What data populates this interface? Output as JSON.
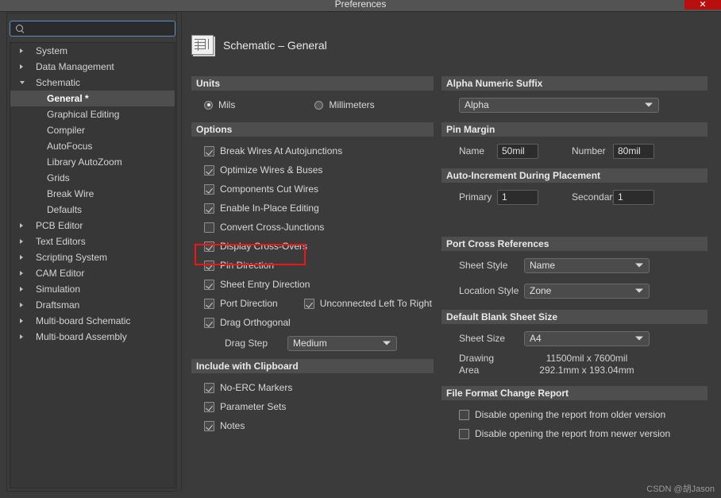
{
  "window": {
    "title": "Preferences",
    "close_label": "✕"
  },
  "sidebar": {
    "search": {
      "value": "",
      "placeholder": ""
    },
    "items": [
      {
        "label": "System",
        "level": 0,
        "state": "collapsed",
        "selected": false
      },
      {
        "label": "Data Management",
        "level": 0,
        "state": "collapsed",
        "selected": false
      },
      {
        "label": "Schematic",
        "level": 0,
        "state": "expanded",
        "selected": false
      },
      {
        "label": "General *",
        "level": 1,
        "state": "leaf",
        "selected": true
      },
      {
        "label": "Graphical Editing",
        "level": 1,
        "state": "leaf",
        "selected": false
      },
      {
        "label": "Compiler",
        "level": 1,
        "state": "leaf",
        "selected": false
      },
      {
        "label": "AutoFocus",
        "level": 1,
        "state": "leaf",
        "selected": false
      },
      {
        "label": "Library AutoZoom",
        "level": 1,
        "state": "leaf",
        "selected": false
      },
      {
        "label": "Grids",
        "level": 1,
        "state": "leaf",
        "selected": false
      },
      {
        "label": "Break Wire",
        "level": 1,
        "state": "leaf",
        "selected": false
      },
      {
        "label": "Defaults",
        "level": 1,
        "state": "leaf",
        "selected": false
      },
      {
        "label": "PCB Editor",
        "level": 0,
        "state": "collapsed",
        "selected": false
      },
      {
        "label": "Text Editors",
        "level": 0,
        "state": "collapsed",
        "selected": false
      },
      {
        "label": "Scripting System",
        "level": 0,
        "state": "collapsed",
        "selected": false
      },
      {
        "label": "CAM Editor",
        "level": 0,
        "state": "collapsed",
        "selected": false
      },
      {
        "label": "Simulation",
        "level": 0,
        "state": "collapsed",
        "selected": false
      },
      {
        "label": "Draftsman",
        "level": 0,
        "state": "collapsed",
        "selected": false
      },
      {
        "label": "Multi-board Schematic",
        "level": 0,
        "state": "collapsed",
        "selected": false
      },
      {
        "label": "Multi-board Assembly",
        "level": 0,
        "state": "collapsed",
        "selected": false
      }
    ]
  },
  "page": {
    "title": "Schematic – General",
    "icon": "schematic-icon"
  },
  "units": {
    "header": "Units",
    "options": [
      {
        "label": "Mils",
        "checked": true
      },
      {
        "label": "Millimeters",
        "checked": false
      }
    ]
  },
  "options": {
    "header": "Options",
    "items": [
      {
        "label": "Break Wires At Autojunctions",
        "checked": true
      },
      {
        "label": "Optimize Wires & Buses",
        "checked": true
      },
      {
        "label": "Components Cut Wires",
        "checked": true
      },
      {
        "label": "Enable In-Place Editing",
        "checked": true
      },
      {
        "label": "Convert Cross-Junctions",
        "checked": false
      },
      {
        "label": "Display Cross-Overs",
        "checked": true,
        "highlighted": true
      },
      {
        "label": "Pin Direction",
        "checked": true
      },
      {
        "label": "Sheet Entry Direction",
        "checked": true
      },
      {
        "label": "Port Direction",
        "checked": true
      },
      {
        "label": "Drag Orthogonal",
        "checked": true
      }
    ],
    "unconnected_left_to_right": {
      "label": "Unconnected Left To Right",
      "checked": true
    },
    "drag_step": {
      "label": "Drag Step",
      "value": "Medium"
    }
  },
  "clipboard": {
    "header": "Include with Clipboard",
    "items": [
      {
        "label": "No-ERC Markers",
        "checked": true
      },
      {
        "label": "Parameter Sets",
        "checked": true
      },
      {
        "label": "Notes",
        "checked": true
      }
    ]
  },
  "alpha_numeric_suffix": {
    "header": "Alpha Numeric Suffix",
    "value": "Alpha"
  },
  "pin_margin": {
    "header": "Pin Margin",
    "name_label": "Name",
    "name_value": "50mil",
    "number_label": "Number",
    "number_value": "80mil"
  },
  "auto_increment": {
    "header": "Auto-Increment During Placement",
    "primary_label": "Primary",
    "primary_value": "1",
    "secondary_label": "Secondary",
    "secondary_value": "1"
  },
  "port_cross_refs": {
    "header": "Port Cross References",
    "sheet_style_label": "Sheet Style",
    "sheet_style_value": "Name",
    "location_style_label": "Location Style",
    "location_style_value": "Zone"
  },
  "sheet_size": {
    "header": "Default Blank Sheet Size",
    "size_label": "Sheet Size",
    "size_value": "A4",
    "drawing_label_line1": "Drawing",
    "drawing_label_line2": "Area",
    "dims_mil": "11500mil x 7600mil",
    "dims_mm": "292.1mm x 193.04mm"
  },
  "file_format_report": {
    "header": "File Format Change Report",
    "items": [
      {
        "label": "Disable opening the report from older version",
        "checked": false
      },
      {
        "label": "Disable opening the report from newer version",
        "checked": false
      }
    ]
  },
  "watermark": "CSDN @胡Jason",
  "colors": {
    "accent_red": "#f01414",
    "close_red": "#b90e0e",
    "focus_blue": "#5a8ec4",
    "section_header_bg": "#4e4e4e",
    "panel_bg": "#3b3b3b"
  }
}
